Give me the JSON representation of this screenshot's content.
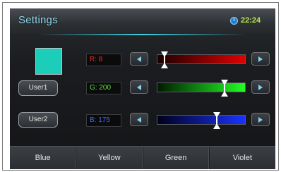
{
  "header": {
    "title": "Settings",
    "time": "22:24"
  },
  "color": {
    "swatch": "#1ccdb9"
  },
  "presets": {
    "user1": "User1",
    "user2": "User2"
  },
  "channels": {
    "red": {
      "label": "R: 8",
      "value": 8,
      "max": 255,
      "text_color": "#e33333",
      "gradient": [
        "#1a0000",
        "#e00000"
      ]
    },
    "green": {
      "label": "G: 200",
      "value": 200,
      "max": 255,
      "text_color": "#5ee33a",
      "gradient": [
        "#001a00",
        "#22ff22"
      ]
    },
    "blue": {
      "label": "B: 175",
      "value": 175,
      "max": 255,
      "text_color": "#3a6bff",
      "gradient": [
        "#00001a",
        "#1a33ff"
      ]
    }
  },
  "tabs": [
    "Blue",
    "Yellow",
    "Green",
    "Violet"
  ]
}
